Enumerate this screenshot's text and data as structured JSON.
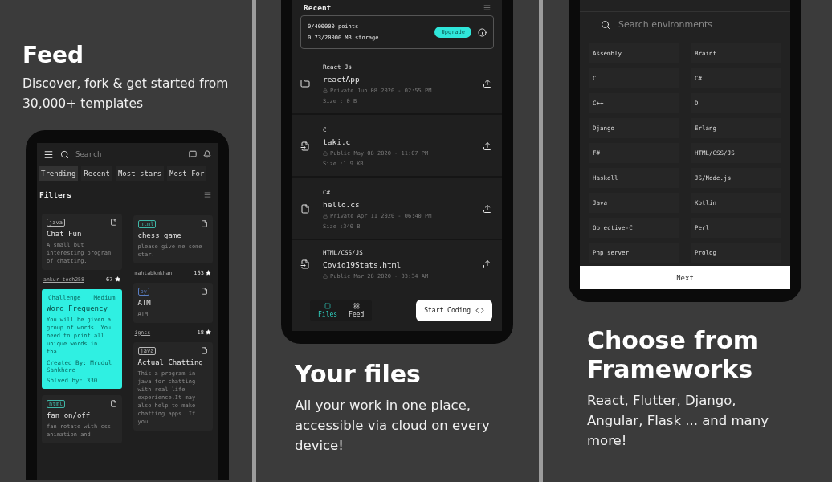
{
  "feed_panel": {
    "title": "Feed",
    "description": "Discover, fork & get started from 30,000+ templates",
    "search_placeholder": "Search",
    "tabs": [
      {
        "label": "Trending",
        "selected": true
      },
      {
        "label": "Recent",
        "selected": false
      },
      {
        "label": "Most stars",
        "selected": false
      },
      {
        "label": "Most For",
        "selected": false
      }
    ],
    "filters_label": "Filters",
    "columns": [
      [
        {
          "kind": "project",
          "tag": "java",
          "color": "#b8b8b8",
          "title": "Chat Fun",
          "description": "A small but interesting program of chatting.",
          "author": "ankur_tech258",
          "stars_count": "67"
        },
        {
          "kind": "challenge",
          "category": "Challenge",
          "level": "Medium",
          "title": "Word Frequency",
          "description": "You will be given a group of words. You need to print all unique words in tha..",
          "created_by": "Created By: Mrudul Sankhere",
          "solved_by": "Solved by: 330"
        },
        {
          "kind": "project",
          "tag": "html",
          "color": "#3fb8a8",
          "title": "fan on/off",
          "description": "fan rotate with css animation and"
        }
      ],
      [
        {
          "kind": "project",
          "tag": "html",
          "color": "#3fb8a8",
          "title": "chess game",
          "description": "please give me some star.",
          "author": "mahtabkmkhan",
          "stars_count": "163"
        },
        {
          "kind": "project",
          "tag": "py",
          "color": "#5a7fc4",
          "title": "ATM",
          "description": "ATM",
          "author": "ignss",
          "stars_count": "18"
        },
        {
          "kind": "project",
          "tag": "java",
          "color": "#b8b8b8",
          "title": "Actual Chatting",
          "description": "This a program in java for chatting with real life experience.It may also help to make chatting apps. If you"
        }
      ]
    ]
  },
  "files_panel": {
    "header": "Recent",
    "points": "0/400000 points",
    "storage": "0.73/20000 MB storage",
    "upgrade": "Upgrade",
    "files": [
      {
        "kind": "folder",
        "language": "React Js",
        "name": "reactApp",
        "visibility": "Private",
        "date": "Jun 08 2020 - 02:55 PM",
        "size": "Size : 0 B"
      },
      {
        "kind": "shared",
        "language": "C",
        "name": "taki.c",
        "visibility": "Public",
        "date": "May 08 2020 - 11:07 PM",
        "size": "Size :1.9 KB"
      },
      {
        "kind": "file",
        "language": "C#",
        "name": "hello.cs",
        "visibility": "Private",
        "date": "Apr 11 2020 - 06:40 PM",
        "size": "Size :340 B"
      },
      {
        "kind": "shared",
        "language": "HTML/CSS/JS",
        "name": "Covid19Stats.html",
        "visibility": "Public",
        "date": "Mar 28 2020 - 03:34 AM"
      }
    ],
    "nav": [
      {
        "label": "Files",
        "selected": true
      },
      {
        "label": "Feed",
        "selected": false
      }
    ],
    "start_coding": "Start Coding",
    "title": "Your files",
    "description": "All your work in one place, accessible via cloud on every device!"
  },
  "frameworks_panel": {
    "search_placeholder": "Search environments",
    "environments": [
      "Assembly",
      "Brainf",
      "C",
      "C#",
      "C++",
      "D",
      "Django",
      "Erlang",
      "F#",
      "HTML/CSS/JS",
      "Haskell",
      "JS/Node.js",
      "Java",
      "Kotlin",
      "Objective-C",
      "Perl",
      "Php server",
      "Prolog"
    ],
    "next": "Next",
    "title": "Choose from Frameworks",
    "description": "React, Flutter, Django, Angular, Flask ... and many more!"
  }
}
